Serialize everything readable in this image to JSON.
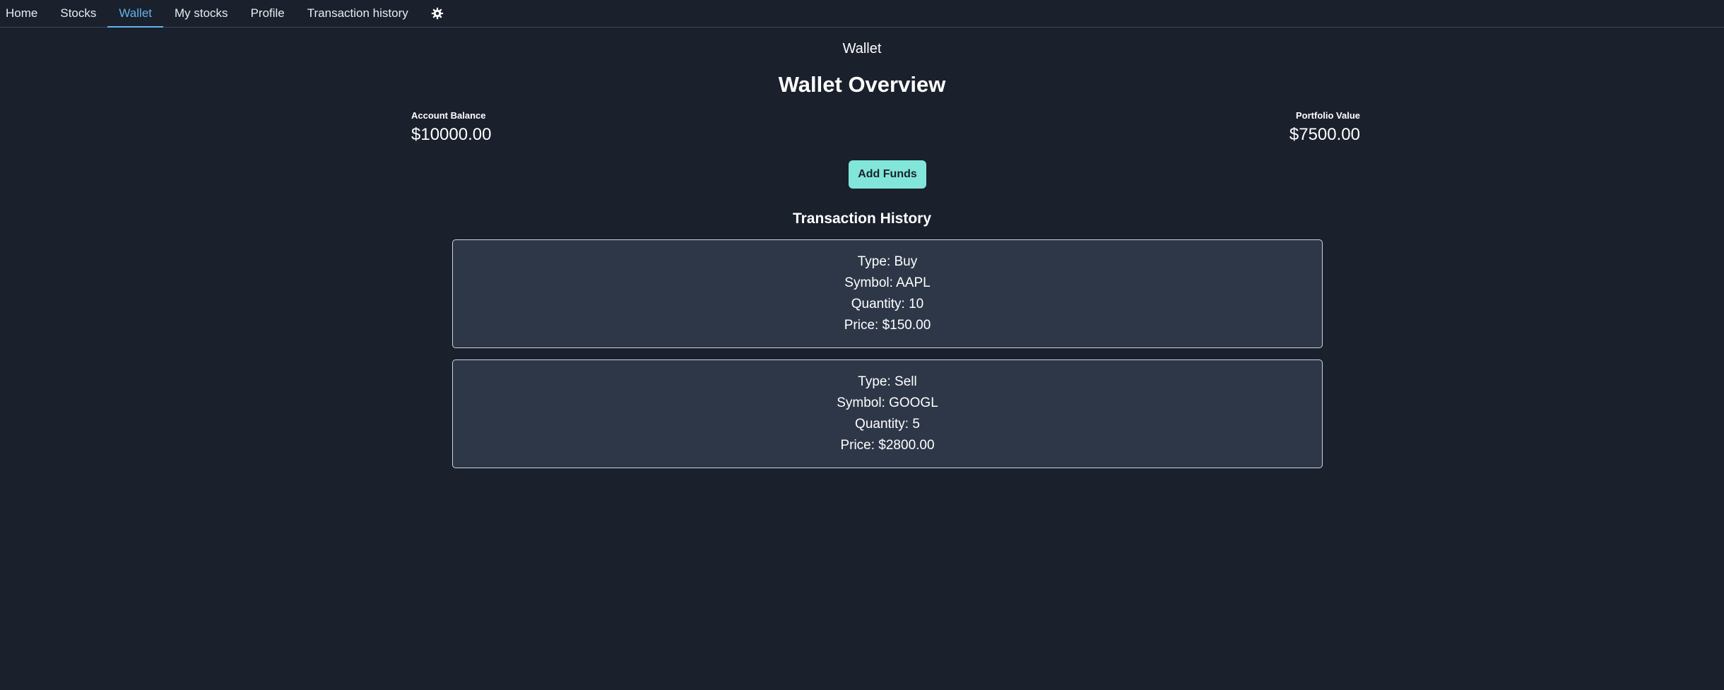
{
  "nav": {
    "tabs": [
      {
        "label": "Home"
      },
      {
        "label": "Stocks"
      },
      {
        "label": "Wallet"
      },
      {
        "label": "My stocks"
      },
      {
        "label": "Profile"
      },
      {
        "label": "Transaction history"
      }
    ],
    "active_tab": "Wallet",
    "settings_icon": "gear-icon"
  },
  "page": {
    "heading": "Wallet",
    "title": "Wallet Overview"
  },
  "account_balance": {
    "label": "Account Balance",
    "value": "$10000.00"
  },
  "portfolio_value": {
    "label": "Portfolio Value",
    "value": "$7500.00"
  },
  "add_funds_label": "Add Funds",
  "history": {
    "title": "Transaction History",
    "transactions": [
      {
        "type": "Type: Buy",
        "symbol": "Symbol: AAPL",
        "quantity": "Quantity: 10",
        "price": "Price: $150.00"
      },
      {
        "type": "Type: Sell",
        "symbol": "Symbol: GOOGL",
        "quantity": "Quantity: 5",
        "price": "Price: $2800.00"
      }
    ]
  },
  "colors": {
    "background": "#1a202c",
    "card": "#2d3748",
    "accent": "#63b3ed",
    "button": "#81e6d9"
  }
}
